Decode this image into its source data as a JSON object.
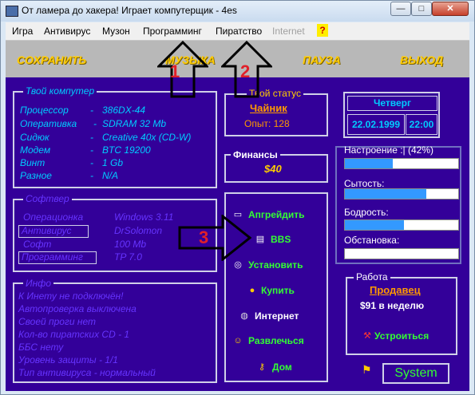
{
  "window": {
    "title": "От ламера до хакера! Играет компутерщик - 4es"
  },
  "menu": [
    "Игра",
    "Антивирус",
    "Музон",
    "Программинг",
    "Пиратство",
    "Internet"
  ],
  "toolbar": [
    "СОХРАНИТЬ",
    "МУЗЫКА",
    "ПАУЗА",
    "ВЫХОД"
  ],
  "computer": {
    "title": "Твой компутер",
    "rows": [
      {
        "label": "Процессор",
        "value": "386DX-44"
      },
      {
        "label": "Оперативка",
        "value": "SDRAM 32 Mb"
      },
      {
        "label": "Сидюк",
        "value": "Creative 40x (CD-W)"
      },
      {
        "label": "Модем",
        "value": "BTC 19200"
      },
      {
        "label": "Винт",
        "value": "1 Gb"
      },
      {
        "label": "Разное",
        "value": "N/A"
      }
    ]
  },
  "software": {
    "title": "Софтвер",
    "rows": [
      {
        "label": "Операционка",
        "value": "Windows 3.11"
      },
      {
        "label": "Антивирус",
        "value": "DrSolomon"
      },
      {
        "label": "Софт",
        "value": "100 Mb"
      },
      {
        "label": "Программинг",
        "value": "TP 7.0"
      }
    ]
  },
  "info": {
    "title": "Инфо",
    "lines": [
      "К Инету не подключён!",
      "Автопроверка выключена",
      "Своей проги нет",
      "Кол-во пиратских CD - 1",
      "ББС нету",
      "Уровень защиты - 1/1",
      "Тип антивируса - нормальный"
    ]
  },
  "status": {
    "title": "Твой статус",
    "rank": "Чайник",
    "exp": "Опыт: 128"
  },
  "finance": {
    "title": "Финансы",
    "amount": "$40"
  },
  "date": {
    "weekday": "Четверг",
    "date": "22.02.1999",
    "time": "22:00"
  },
  "meters": [
    {
      "label": "Настроение :| (42%)",
      "value": 0.42
    },
    {
      "label": "Сытость:",
      "value": 0.72
    },
    {
      "label": "Бодрость:",
      "value": 0.52
    },
    {
      "label": "Обстановка:",
      "value": 0.0
    }
  ],
  "actions": [
    {
      "icon": "computer-icon",
      "label": "Апгрейдить"
    },
    {
      "icon": "bbs-icon",
      "label": "BBS"
    },
    {
      "icon": "cd-icon",
      "label": "Установить"
    },
    {
      "icon": "money-icon",
      "label": "Купить"
    },
    {
      "icon": "internet-icon",
      "label": "Интернет"
    },
    {
      "icon": "smiley-icon",
      "label": "Развлечься"
    },
    {
      "icon": "key-icon",
      "label": "Дом"
    }
  ],
  "job": {
    "title": "Работа",
    "position": "Продавец",
    "salary": "$91 в неделю",
    "apply": "Устроиться"
  },
  "system_button": "System",
  "annotations": [
    "1",
    "2",
    "3"
  ]
}
